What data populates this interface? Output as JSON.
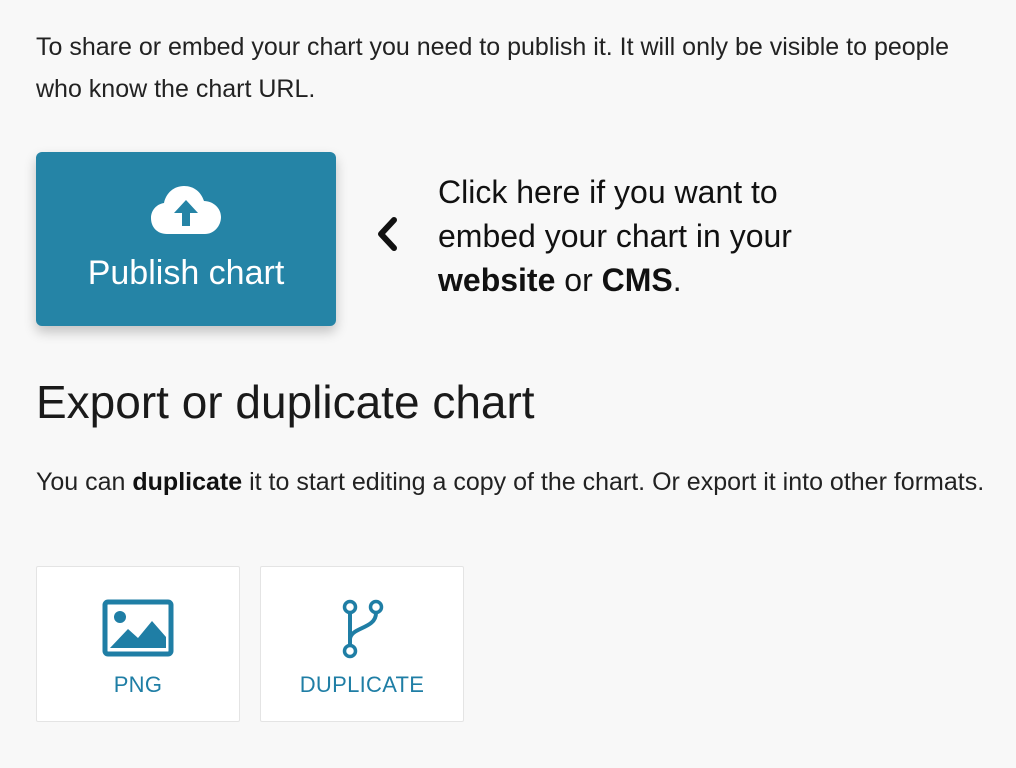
{
  "publish": {
    "intro": "To share or embed your chart you need to publish it. It will only be visible to people who know the chart URL.",
    "button_label": "Publish chart",
    "button_icon": "cloud-upload-icon",
    "pointer_icon": "chevron-left-icon",
    "hint": {
      "text1": "Click here if you want to embed your chart in your ",
      "bold1": "website",
      "text2": " or ",
      "bold2": "CMS",
      "text3": "."
    },
    "button_color": "#2584a6"
  },
  "export": {
    "title": "Export or duplicate chart",
    "description": {
      "text1": "You can ",
      "bold": "duplicate",
      "text2": " it to start editing a copy of the chart. Or export it into other formats."
    },
    "options": [
      {
        "label": "PNG",
        "icon": "image-icon"
      },
      {
        "label": "DUPLICATE",
        "icon": "code-fork-icon"
      }
    ],
    "accent_color": "#1f7ea5"
  }
}
